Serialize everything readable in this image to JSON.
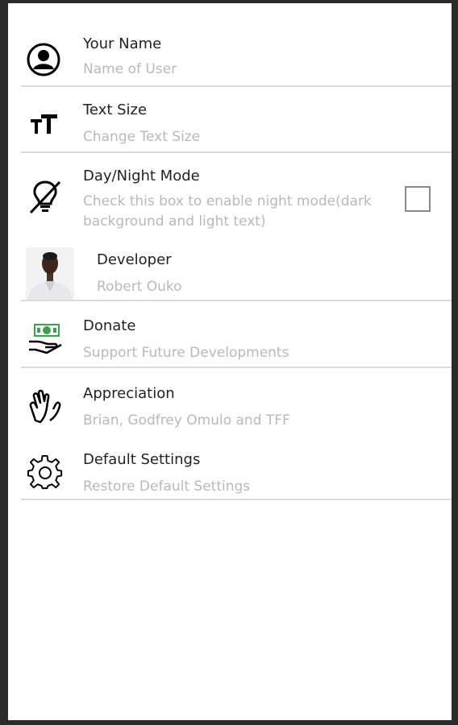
{
  "preferences": {
    "your_name": {
      "title": "Your Name",
      "summary": "Name of User",
      "icon": "account-circle-icon"
    },
    "text_size": {
      "title": "Text Size",
      "summary": "Change Text Size",
      "icon": "text-size-icon"
    },
    "day_night_mode": {
      "title": "Day/Night Mode",
      "summary": "Check this box to enable night mode(dark background and light text)",
      "icon": "lightbulb-off-icon",
      "checked": false
    },
    "developer": {
      "title": "Developer",
      "summary": "Robert Ouko",
      "icon": "developer-photo"
    },
    "donate": {
      "title": "Donate",
      "summary": "Support Future Developments",
      "icon": "money-hand-icon",
      "icon_color": "#3aa24a"
    },
    "appreciation": {
      "title": "Appreciation",
      "summary": "Brian, Godfrey Omulo and TFF",
      "icon": "clapping-hands-icon"
    },
    "default_settings": {
      "title": "Default Settings",
      "summary": "Restore Default Settings",
      "icon": "gear-icon"
    }
  }
}
